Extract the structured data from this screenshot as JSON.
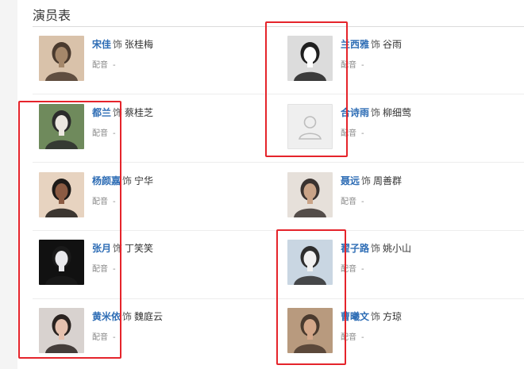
{
  "section": {
    "title": "演员表"
  },
  "cast": [
    {
      "actor": "宋佳",
      "as": "饰",
      "role": "张桂梅",
      "dub_label": "配音",
      "dub_value": "-",
      "photo_colors": [
        "#d9c2aa",
        "#a5876a",
        "#4a3a2e"
      ]
    },
    {
      "actor": "兰西雅",
      "as": "饰",
      "role": "谷雨",
      "dub_label": "配音",
      "dub_value": "-",
      "photo_colors": [
        "#dcdcdc",
        "#ffffff",
        "#1f1f1f"
      ]
    },
    {
      "actor": "都兰",
      "as": "饰",
      "role": "蔡桂芝",
      "dub_label": "配音",
      "dub_value": "-",
      "photo_colors": [
        "#6f8a5c",
        "#ece7e0",
        "#2b2b2b"
      ]
    },
    {
      "actor": "合诗雨",
      "as": "饰",
      "role": "柳细莺",
      "dub_label": "配音",
      "dub_value": "-",
      "photo_colors": null
    },
    {
      "actor": "杨颜嘉",
      "as": "饰",
      "role": "宁华",
      "dub_label": "配音",
      "dub_value": "-",
      "photo_colors": [
        "#e7d3c0",
        "#8b5b43",
        "#1d1a18"
      ]
    },
    {
      "actor": "聂远",
      "as": "饰",
      "role": "周善群",
      "dub_label": "配音",
      "dub_value": "-",
      "photo_colors": [
        "#e6e0da",
        "#caa488",
        "#3a3330"
      ]
    },
    {
      "actor": "张月",
      "as": "饰",
      "role": "丁笑笑",
      "dub_label": "配音",
      "dub_value": "-",
      "photo_colors": [
        "#111111",
        "#e9e9ec",
        "#1a1a1a"
      ]
    },
    {
      "actor": "翟子路",
      "as": "饰",
      "role": "姚小山",
      "dub_label": "配音",
      "dub_value": "-",
      "photo_colors": [
        "#c9d6e2",
        "#f2f2f2",
        "#2e2e2e"
      ]
    },
    {
      "actor": "黄米依",
      "as": "饰",
      "role": "魏庭云",
      "dub_label": "配音",
      "dub_value": "-",
      "photo_colors": [
        "#d8d2cf",
        "#e6c1ae",
        "#2a2320"
      ]
    },
    {
      "actor": "曹曦文",
      "as": "饰",
      "role": "方琼",
      "dub_label": "配音",
      "dub_value": "-",
      "photo_colors": [
        "#b89a7e",
        "#d4a789",
        "#4a3a2e"
      ]
    }
  ],
  "theme": {
    "link_color": "#2e6db5",
    "annotation_color": "#e5242b"
  }
}
